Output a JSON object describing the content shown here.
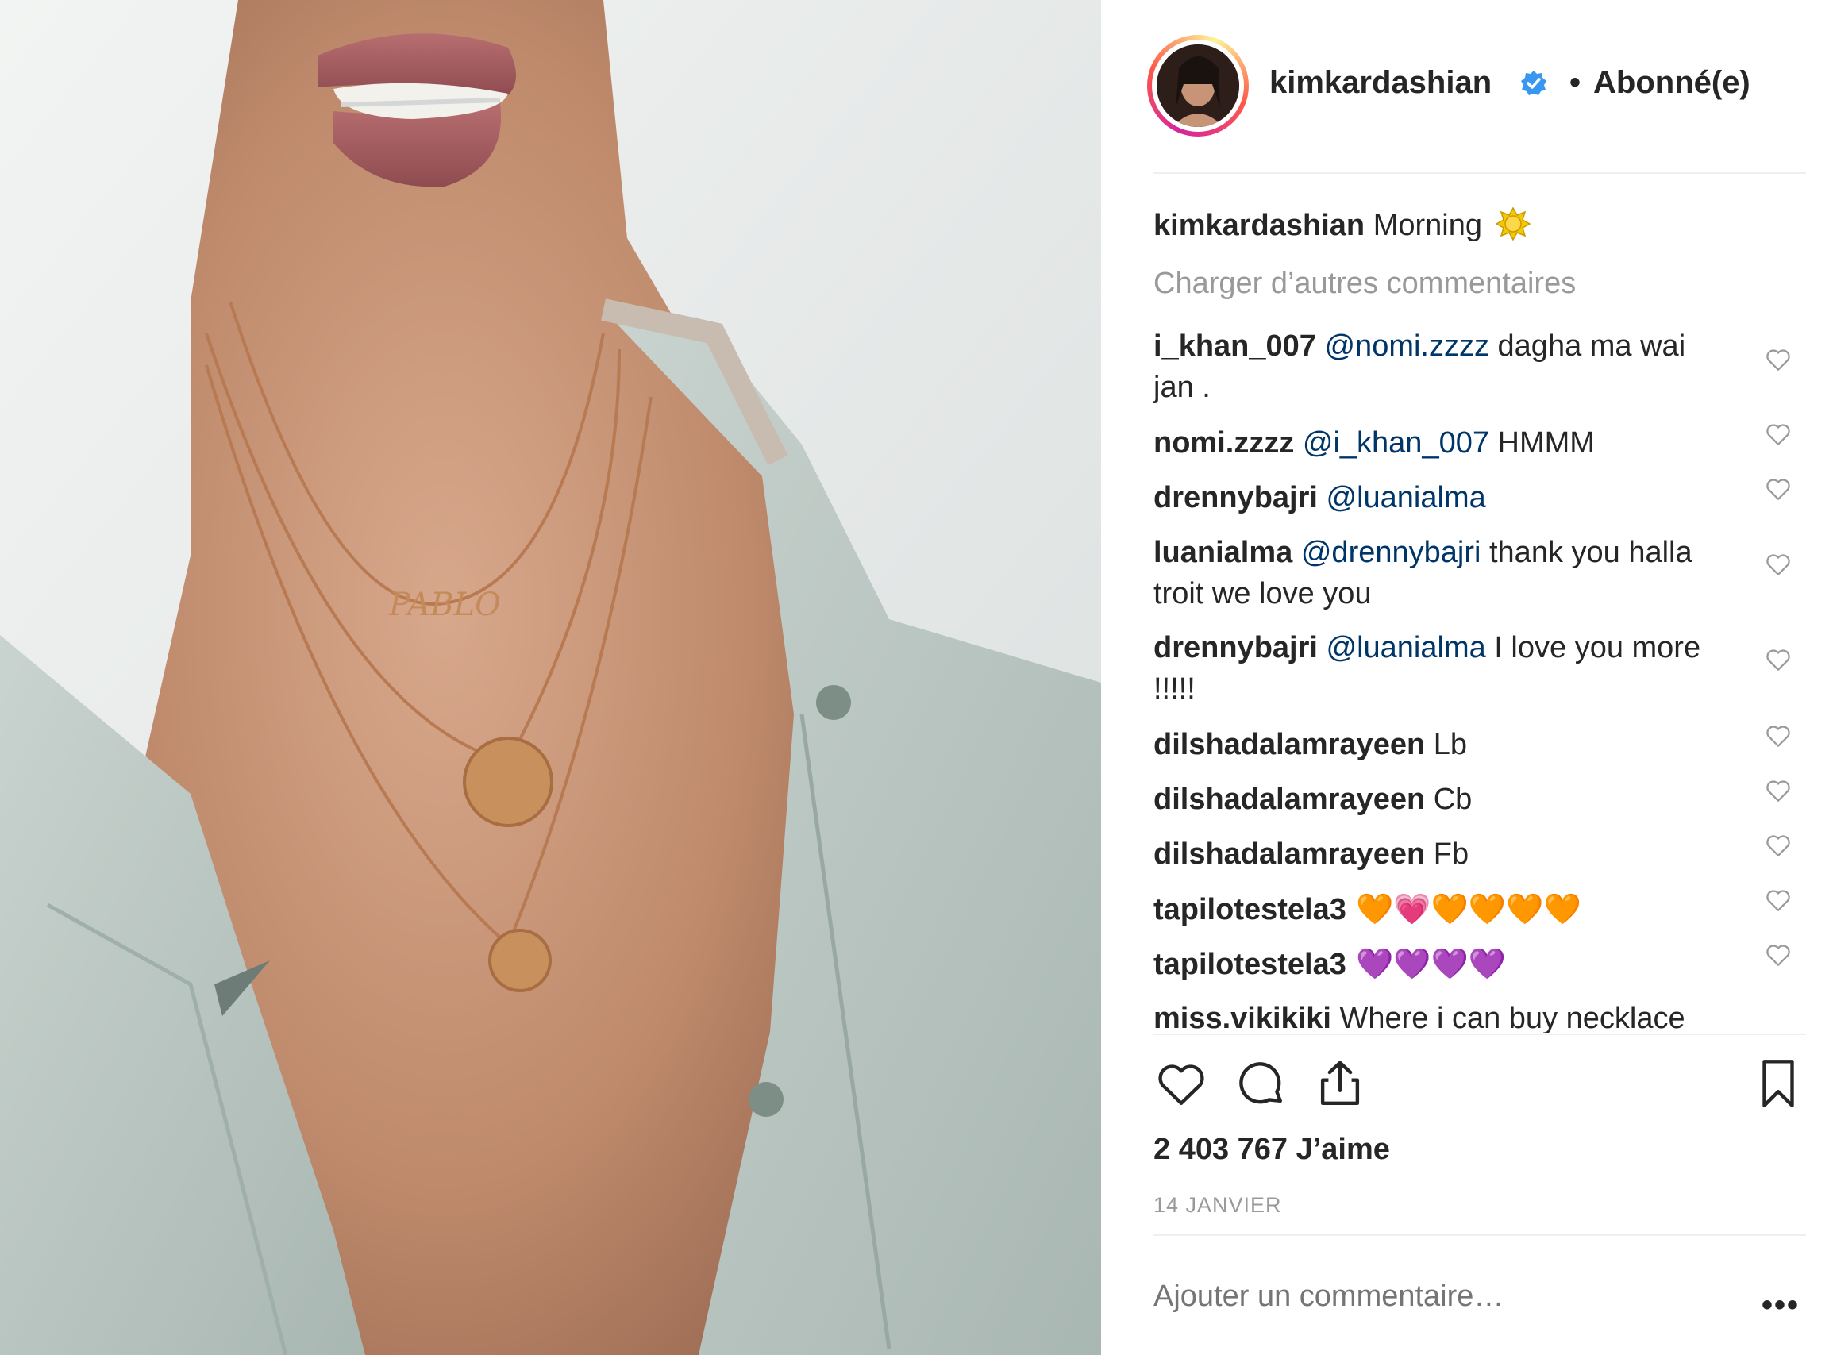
{
  "post": {
    "username": "kimkardashian",
    "follow_status": "Abonné(e)",
    "separator": "•",
    "caption_user": "kimkardashian",
    "caption_text": "Morning",
    "load_more": "Charger d’autres commentaires",
    "likes": "2 403 767 J’aime",
    "date": "14 JANVIER",
    "add_comment_placeholder": "Ajouter un commentaire…",
    "more_options": "•••"
  },
  "comments": [
    {
      "user": "i_khan_007",
      "mention": "@nomi.zzzz",
      "text": " dagha ma wai jan ."
    },
    {
      "user": "nomi.zzzz",
      "mention": "@i_khan_007",
      "text": " HMMM"
    },
    {
      "user": "drennybajri",
      "mention": "@luanialma",
      "text": ""
    },
    {
      "user": "luanialma",
      "mention": "@drennybajri",
      "text": " thank you halla troit we love you"
    },
    {
      "user": "drennybajri",
      "mention": "@luanialma",
      "text": " I love you more !!!!!"
    },
    {
      "user": "dilshadalamrayeen",
      "mention": "",
      "text": " Lb"
    },
    {
      "user": "dilshadalamrayeen",
      "mention": "",
      "text": " Cb"
    },
    {
      "user": "dilshadalamrayeen",
      "mention": "",
      "text": " Fb"
    },
    {
      "user": "tapilotestela3",
      "mention": "",
      "text": " 🧡💗🧡🧡🧡🧡"
    },
    {
      "user": "tapilotestela3",
      "mention": "",
      "text": " 💜💜💜💜"
    },
    {
      "user": "miss.vikikiki",
      "mention": "",
      "text": " Where i can buy necklace"
    }
  ],
  "icons": {
    "like": "heart-icon",
    "comment": "comment-icon",
    "share": "share-icon",
    "save": "bookmark-icon",
    "verified": "verified-badge-icon",
    "sun": "sun-emoji-icon"
  },
  "colors": {
    "mention": "#003569",
    "muted": "#999999",
    "verified": "#3897f0"
  }
}
